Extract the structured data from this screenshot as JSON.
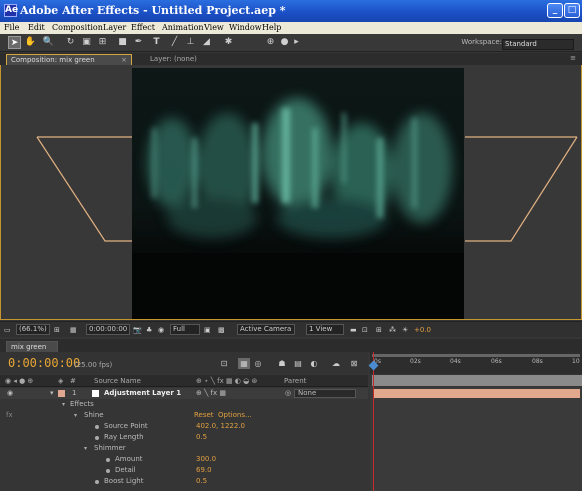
{
  "window": {
    "title": "Adobe After Effects - Untitled Project.aep *"
  },
  "menu": [
    "File",
    "Edit",
    "Composition",
    "Layer",
    "Effect",
    "Animation",
    "View",
    "Window",
    "Help"
  ],
  "toolbar": {
    "workspace_label": "Workspace:",
    "workspace_value": "Standard"
  },
  "comp_panel": {
    "tab_label": "Composition: mix green",
    "layer_tab": "Layer: (none)",
    "zoom": "(66.1%)",
    "timecode": "0:00:00:00",
    "resolution": "Full",
    "camera": "Active Camera",
    "view": "1 View",
    "exposure": "+0.0"
  },
  "timeline": {
    "tab_label": "mix green",
    "timecode": "0:00:00:00",
    "fps": "(25.00 fps)",
    "columns": {
      "num": "#",
      "source": "Source Name",
      "parent": "Parent"
    },
    "ruler_ticks": [
      "0s",
      "02s",
      "04s",
      "06s",
      "08s",
      "10"
    ],
    "layer": {
      "index": "1",
      "name": "Adjustment Layer 1",
      "parent": "None"
    },
    "effects_label": "Effects",
    "effect": {
      "name": "Shine",
      "reset": "Reset",
      "options": "Options..."
    },
    "props": [
      {
        "name": "Source Point",
        "value": "402.0, 1222.0"
      },
      {
        "name": "Ray Length",
        "value": "0.5"
      }
    ],
    "group": "Shimmer",
    "shimmer_props": [
      {
        "name": "Amount",
        "value": "300.0"
      },
      {
        "name": "Detail",
        "value": "69.0"
      }
    ],
    "boost": {
      "name": "Boost Light",
      "value": "0.5"
    }
  }
}
